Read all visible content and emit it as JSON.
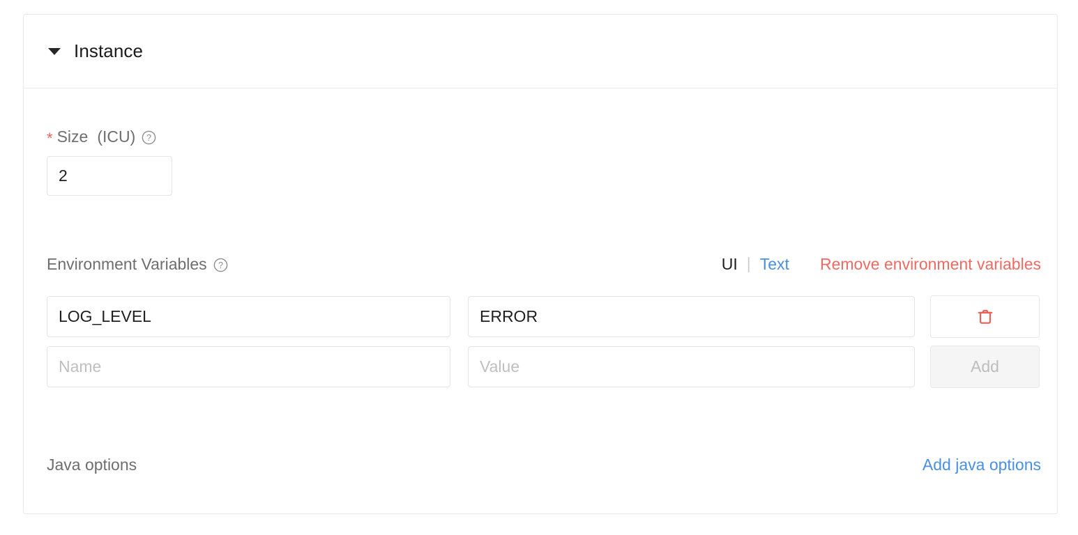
{
  "panel": {
    "title": "Instance",
    "collapse_icon": "caret-down-icon",
    "expanded": true
  },
  "size_field": {
    "required_marker": "*",
    "label": "Size",
    "unit": "(ICU)",
    "help_icon": "help-circle-icon",
    "value": "2",
    "placeholder": ""
  },
  "env_vars": {
    "label": "Environment Variables",
    "help_icon": "help-circle-icon",
    "mode_ui_label": "UI",
    "mode_separator": "|",
    "mode_text_label": "Text",
    "remove_label": "Remove environment variables",
    "name_placeholder": "Name",
    "value_placeholder": "Value",
    "rows": [
      {
        "name": "LOG_LEVEL",
        "value": "ERROR",
        "action_label": "",
        "action_icon": "trash-icon"
      }
    ],
    "new_row": {
      "name": "",
      "value": "",
      "action_label": "Add",
      "action_icon": ""
    }
  },
  "java_options": {
    "label": "Java options",
    "add_link": "Add java options"
  },
  "colors": {
    "accent_link": "#4a90e2",
    "danger": "#ef6a62",
    "label_text": "#6e6e6e",
    "border": "#e4e4e4",
    "disabled_bg": "#f5f5f5"
  }
}
